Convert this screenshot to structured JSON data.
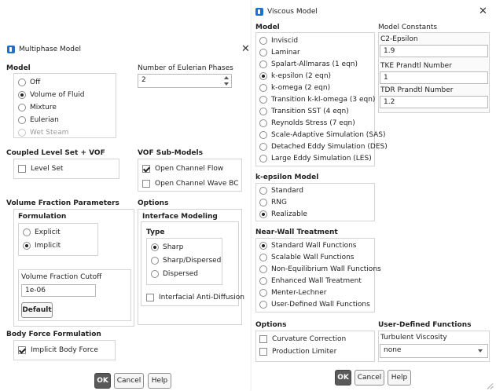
{
  "multiphase": {
    "title": "Multiphase Model",
    "model": {
      "heading": "Model",
      "options": [
        {
          "label": "Off",
          "checked": false,
          "disabled": false
        },
        {
          "label": "Volume of Fluid",
          "checked": true,
          "disabled": false
        },
        {
          "label": "Mixture",
          "checked": false,
          "disabled": false
        },
        {
          "label": "Eulerian",
          "checked": false,
          "disabled": false
        },
        {
          "label": "Wet Steam",
          "checked": false,
          "disabled": true
        }
      ]
    },
    "phases": {
      "label": "Number of Eulerian Phases",
      "value": "2"
    },
    "coupled": {
      "heading": "Coupled Level Set + VOF",
      "level_set": "Level Set"
    },
    "vof_sub": {
      "heading": "VOF Sub-Models",
      "open_channel_flow": "Open Channel Flow",
      "open_channel_wave": "Open Channel Wave BC"
    },
    "vf_params": {
      "heading": "Volume Fraction Parameters",
      "formulation": "Formulation",
      "explicit": "Explicit",
      "implicit": "Implicit",
      "cutoff_label": "Volume Fraction Cutoff",
      "cutoff_value": "1e-06",
      "default_btn": "Default"
    },
    "options": {
      "heading": "Options",
      "interface_modeling": "Interface Modeling",
      "type": "Type",
      "sharp": "Sharp",
      "sharp_dispersed": "Sharp/Dispersed",
      "dispersed": "Dispersed",
      "anti_diffusion": "Interfacial Anti-Diffusion"
    },
    "body_force": {
      "heading": "Body Force Formulation",
      "implicit": "Implicit Body Force"
    },
    "buttons": {
      "ok": "OK",
      "cancel": "Cancel",
      "help": "Help"
    }
  },
  "viscous": {
    "title": "Viscous Model",
    "model": {
      "heading": "Model",
      "options": [
        {
          "label": "Inviscid",
          "checked": false
        },
        {
          "label": "Laminar",
          "checked": false
        },
        {
          "label": "Spalart-Allmaras (1 eqn)",
          "checked": false
        },
        {
          "label": "k-epsilon (2 eqn)",
          "checked": true
        },
        {
          "label": "k-omega (2 eqn)",
          "checked": false
        },
        {
          "label": "Transition k-kl-omega (3 eqn)",
          "checked": false
        },
        {
          "label": "Transition SST (4 eqn)",
          "checked": false
        },
        {
          "label": "Reynolds Stress (7 eqn)",
          "checked": false
        },
        {
          "label": "Scale-Adaptive Simulation (SAS)",
          "checked": false
        },
        {
          "label": "Detached Eddy Simulation (DES)",
          "checked": false
        },
        {
          "label": "Large Eddy Simulation (LES)",
          "checked": false
        }
      ]
    },
    "constants": {
      "heading": "Model Constants",
      "c2_label": "C2-Epsilon",
      "c2_value": "1.9",
      "tke_label": "TKE Prandtl Number",
      "tke_value": "1",
      "tdr_label": "TDR Prandtl Number",
      "tdr_value": "1.2"
    },
    "ke_model": {
      "heading": "k-epsilon Model",
      "options": [
        {
          "label": "Standard",
          "checked": false
        },
        {
          "label": "RNG",
          "checked": false
        },
        {
          "label": "Realizable",
          "checked": true
        }
      ]
    },
    "near_wall": {
      "heading": "Near-Wall Treatment",
      "options": [
        {
          "label": "Standard Wall Functions",
          "checked": true
        },
        {
          "label": "Scalable Wall Functions",
          "checked": false
        },
        {
          "label": "Non-Equilibrium Wall Functions",
          "checked": false
        },
        {
          "label": "Enhanced Wall Treatment",
          "checked": false
        },
        {
          "label": "Menter-Lechner",
          "checked": false
        },
        {
          "label": "User-Defined Wall Functions",
          "checked": false
        }
      ]
    },
    "options": {
      "heading": "Options",
      "curvature": "Curvature Correction",
      "production": "Production Limiter"
    },
    "udf": {
      "heading": "User-Defined Functions",
      "turb_visc_label": "Turbulent Viscosity",
      "turb_visc_value": "none"
    },
    "buttons": {
      "ok": "OK",
      "cancel": "Cancel",
      "help": "Help"
    }
  }
}
